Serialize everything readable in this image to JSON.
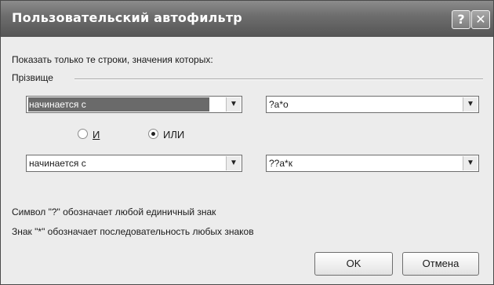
{
  "window": {
    "title": "Пользовательский автофильтр",
    "help_glyph": "?",
    "close_glyph": "✕"
  },
  "dialog": {
    "instruction": "Показать только те строки, значения которых:",
    "field_name": "Прізвище",
    "condition1": {
      "operator": "начинается с",
      "value": "?а*о"
    },
    "logic": {
      "and_label": "И",
      "or_label": "ИЛИ",
      "selected": "or"
    },
    "condition2": {
      "operator": "начинается с",
      "value": "??а*к"
    },
    "hint1": "Символ \"?\" обозначает любой единичный знак",
    "hint2": "Знак \"*\" обозначает последовательность любых знаков"
  },
  "buttons": {
    "ok": "OK",
    "cancel": "Отмена"
  },
  "icons": {
    "dropdown": "▼"
  }
}
